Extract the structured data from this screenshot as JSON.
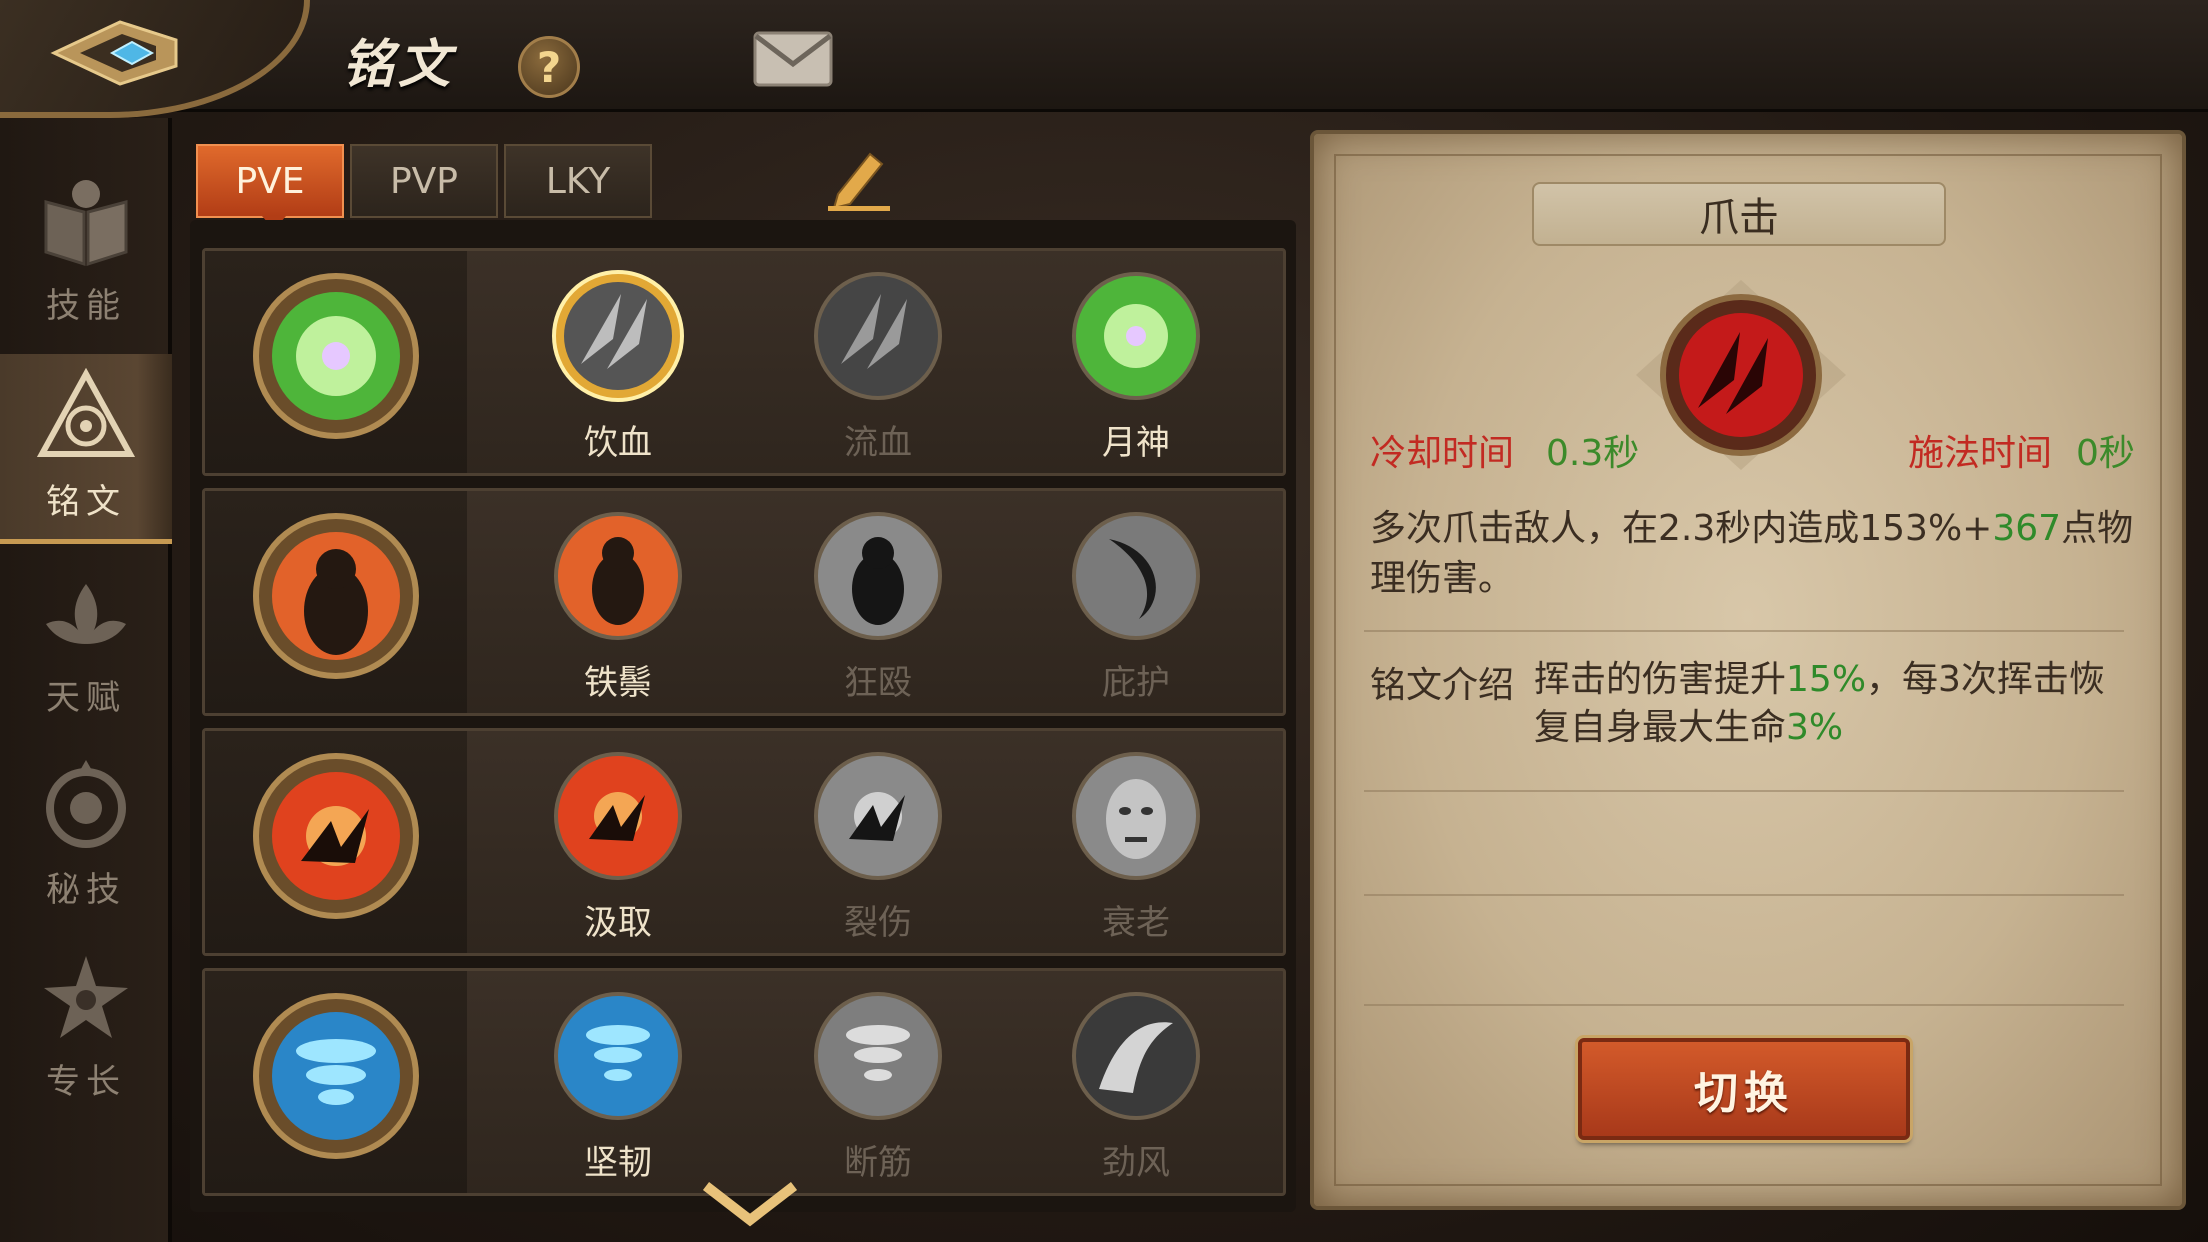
{
  "header": {
    "title": "铭文",
    "help": "?"
  },
  "sidebar": {
    "items": [
      {
        "label": "技能",
        "icon": "book-icon"
      },
      {
        "label": "铭文",
        "icon": "rune-triangle-icon",
        "active": true
      },
      {
        "label": "天赋",
        "icon": "lotus-icon"
      },
      {
        "label": "秘技",
        "icon": "shield-emblem-icon"
      },
      {
        "label": "专长",
        "icon": "star-emblem-icon"
      }
    ]
  },
  "tabs": [
    {
      "label": "PVE",
      "active": true
    },
    {
      "label": "PVP"
    },
    {
      "label": "LKY"
    }
  ],
  "rows": [
    {
      "slots": [
        {
          "label": "饮血"
        },
        {
          "label": "流血"
        },
        {
          "label": "月神"
        }
      ]
    },
    {
      "slots": [
        {
          "label": "铁鬃"
        },
        {
          "label": "狂殴"
        },
        {
          "label": "庇护"
        }
      ]
    },
    {
      "slots": [
        {
          "label": "汲取"
        },
        {
          "label": "裂伤"
        },
        {
          "label": "衰老"
        }
      ]
    },
    {
      "slots": [
        {
          "label": "坚韧"
        },
        {
          "label": "断筋"
        },
        {
          "label": "劲风"
        }
      ]
    }
  ],
  "detail": {
    "skill_name": "爪击",
    "cooldown_label": "冷却时间",
    "cooldown_value": "0.3秒",
    "cast_label": "施法时间",
    "cast_value": "0秒",
    "desc_part1": "多次爪击敌人，在2.3秒内造成153%+",
    "desc_value": "367",
    "desc_part2": "点物理伤害。",
    "insc_label": "铭文介绍",
    "insc_part1": "挥击的伤害提升",
    "insc_value1": "15%",
    "insc_part2": "，每3次挥击恢复自身最大生命",
    "insc_value2": "3%",
    "switch_label": "切换"
  },
  "colors": {
    "accent_orange": "#d35a2a",
    "stat_red": "#c22a22",
    "value_green": "#2f8a2a",
    "gold": "#c79a52"
  }
}
